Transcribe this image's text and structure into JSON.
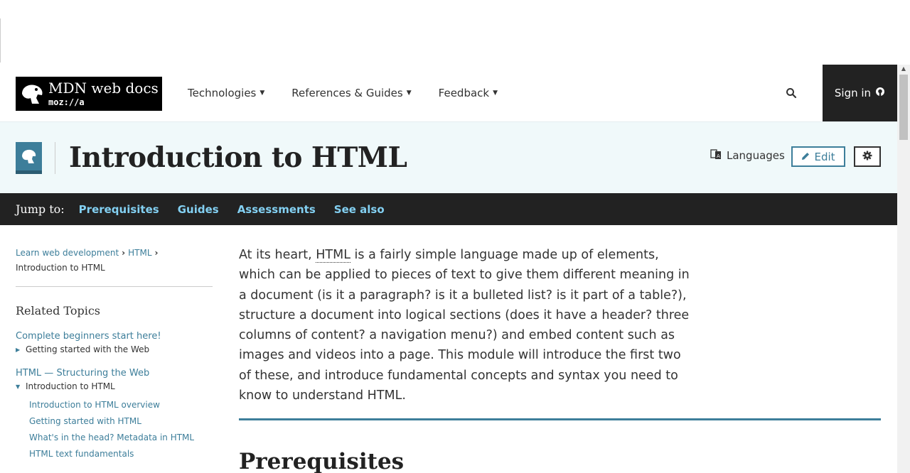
{
  "header": {
    "logo_line1": "MDN web docs",
    "logo_line2": "moz://a",
    "nav": [
      {
        "label": "Technologies"
      },
      {
        "label": "References & Guides"
      },
      {
        "label": "Feedback"
      }
    ],
    "signin_label": "Sign in"
  },
  "titlebar": {
    "title": "Introduction to HTML",
    "languages_label": "Languages",
    "edit_label": "Edit"
  },
  "jumpbar": {
    "label": "Jump to:",
    "links": [
      "Prerequisites",
      "Guides",
      "Assessments",
      "See also"
    ]
  },
  "sidebar": {
    "breadcrumb": [
      "Learn web development",
      "HTML",
      "Introduction to HTML"
    ],
    "related_title": "Related Topics",
    "sections": [
      {
        "heading": "Complete beginners start here!",
        "item": "Getting started with the Web",
        "expanded": false
      },
      {
        "heading": "HTML — Structuring the Web",
        "item": "Introduction to HTML",
        "expanded": true
      }
    ],
    "subitems": [
      "Introduction to HTML overview",
      "Getting started with HTML",
      "What's in the head? Metadata in HTML",
      "HTML text fundamentals"
    ]
  },
  "content": {
    "intro_before": "At its heart, ",
    "intro_abbr": "HTML",
    "intro_after": " is a fairly simple language made up of elements, which can be applied to pieces of text to give them different meaning in a document (is it a paragraph? is it a bulleted list? is it part of a table?), structure a document into logical sections (does it have a header? three columns of content? a navigation menu?) and embed content such as images and videos into a page. This module will introduce the first two of these, and introduce fundamental concepts and syntax you need to know to understand HTML.",
    "heading": "Prerequisites"
  },
  "colors": {
    "link": "#3d7e9a",
    "jump_link": "#83d0f2",
    "dark": "#222222",
    "title_bg": "#f0f9fa"
  }
}
